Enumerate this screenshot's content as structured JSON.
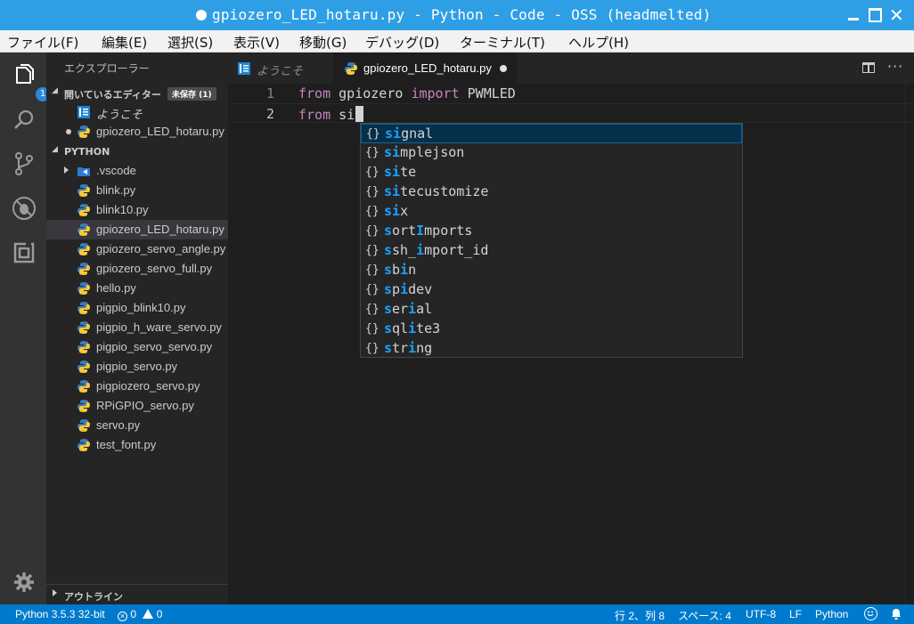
{
  "window": {
    "title": "gpiozero_LED_hotaru.py - Python - Code - OSS (headmelted)",
    "controls": [
      "minimize",
      "maximize",
      "close"
    ],
    "accent_color": "#2f9fe5"
  },
  "menu": {
    "items": [
      {
        "label": "ファイル(F)"
      },
      {
        "label": "編集(E)"
      },
      {
        "label": "選択(S)"
      },
      {
        "label": "表示(V)"
      },
      {
        "label": "移動(G)"
      },
      {
        "label": "デバッグ(D)"
      },
      {
        "label": "ターミナル(T)"
      },
      {
        "label": "ヘルプ(H)"
      }
    ]
  },
  "activity_bar": {
    "icons": [
      "files-icon",
      "search-icon",
      "source-control-icon",
      "debug-icon",
      "extensions-icon",
      "settings-gear-icon"
    ],
    "explorer_badge": "1"
  },
  "sidebar": {
    "title": "エクスプローラー",
    "open_editors": {
      "label": "開いているエディター",
      "badge": "未保存 (1)",
      "items": [
        {
          "label": "ようこそ",
          "icon": "welcome-icon",
          "italic": true
        },
        {
          "label": "gpiozero_LED_hotaru.py",
          "icon": "python-file-icon",
          "dirty": true
        }
      ]
    },
    "folder": {
      "label": "PYTHON",
      "items": [
        {
          "label": ".vscode",
          "icon": "vscode-folder-icon",
          "folder": true
        },
        {
          "label": "blink.py"
        },
        {
          "label": "blink10.py"
        },
        {
          "label": "gpiozero_LED_hotaru.py",
          "selected": true
        },
        {
          "label": "gpiozero_servo_angle.py"
        },
        {
          "label": "gpiozero_servo_full.py"
        },
        {
          "label": "hello.py"
        },
        {
          "label": "pigpio_blink10.py"
        },
        {
          "label": "pigpio_h_ware_servo.py"
        },
        {
          "label": "pigpio_servo_servo.py"
        },
        {
          "label": "pigpio_servo.py"
        },
        {
          "label": "pigpiozero_servo.py"
        },
        {
          "label": "RPiGPIO_servo.py"
        },
        {
          "label": "servo.py"
        },
        {
          "label": "test_font.py"
        }
      ]
    },
    "outline": {
      "label": "アウトライン"
    }
  },
  "tabs": [
    {
      "label": "ようこそ",
      "icon": "welcome-icon",
      "active": false
    },
    {
      "label": "gpiozero_LED_hotaru.py",
      "icon": "python-file-icon",
      "active": true,
      "dirty": true
    }
  ],
  "editor": {
    "lines": [
      {
        "number": "1",
        "tokens": [
          {
            "text": "from",
            "kw": true
          },
          {
            "text": " gpiozero "
          },
          {
            "text": "import",
            "kw": true
          },
          {
            "text": " PWMLED"
          }
        ]
      },
      {
        "number": "2",
        "tokens": [
          {
            "text": "from",
            "kw": true
          },
          {
            "text": " si"
          }
        ],
        "cursor": true
      }
    ]
  },
  "suggestions": {
    "icon": "{}",
    "items": [
      {
        "parts": [
          {
            "t": "si",
            "h": true
          },
          {
            "t": "gnal"
          }
        ],
        "label": "signal",
        "focused": true
      },
      {
        "parts": [
          {
            "t": "si",
            "h": true
          },
          {
            "t": "mplejson"
          }
        ],
        "label": "simplejson"
      },
      {
        "parts": [
          {
            "t": "si",
            "h": true
          },
          {
            "t": "te"
          }
        ],
        "label": "site"
      },
      {
        "parts": [
          {
            "t": "si",
            "h": true
          },
          {
            "t": "tecustomize"
          }
        ],
        "label": "sitecustomize"
      },
      {
        "parts": [
          {
            "t": "si",
            "h": true
          },
          {
            "t": "x"
          }
        ],
        "label": "six"
      },
      {
        "parts": [
          {
            "t": "s",
            "h": true
          },
          {
            "t": "ort"
          },
          {
            "t": "I",
            "h": true
          },
          {
            "t": "mports"
          }
        ],
        "label": "sortImports"
      },
      {
        "parts": [
          {
            "t": "s",
            "h": true
          },
          {
            "t": "sh_"
          },
          {
            "t": "i",
            "h": true
          },
          {
            "t": "mport_id"
          }
        ],
        "label": "ssh_import_id"
      },
      {
        "parts": [
          {
            "t": "s",
            "h": true
          },
          {
            "t": "b"
          },
          {
            "t": "i",
            "h": true
          },
          {
            "t": "n"
          }
        ],
        "label": "sbin"
      },
      {
        "parts": [
          {
            "t": "s",
            "h": true
          },
          {
            "t": "p"
          },
          {
            "t": "i",
            "h": true
          },
          {
            "t": "dev"
          }
        ],
        "label": "spidev"
      },
      {
        "parts": [
          {
            "t": "s",
            "h": true
          },
          {
            "t": "er"
          },
          {
            "t": "i",
            "h": true
          },
          {
            "t": "al"
          }
        ],
        "label": "serial"
      },
      {
        "parts": [
          {
            "t": "s",
            "h": true
          },
          {
            "t": "ql"
          },
          {
            "t": "i",
            "h": true
          },
          {
            "t": "te3"
          }
        ],
        "label": "sqlite3"
      },
      {
        "parts": [
          {
            "t": "s",
            "h": true
          },
          {
            "t": "tr"
          },
          {
            "t": "i",
            "h": true
          },
          {
            "t": "ng"
          }
        ],
        "label": "string"
      }
    ]
  },
  "status": {
    "interpreter": "Python 3.5.3 32-bit",
    "errors": "0",
    "warnings": "0",
    "position": "行 2、列 8",
    "indent": "スペース: 4",
    "encoding": "UTF-8",
    "eol": "LF",
    "language": "Python",
    "bar_color": "#007acc"
  }
}
